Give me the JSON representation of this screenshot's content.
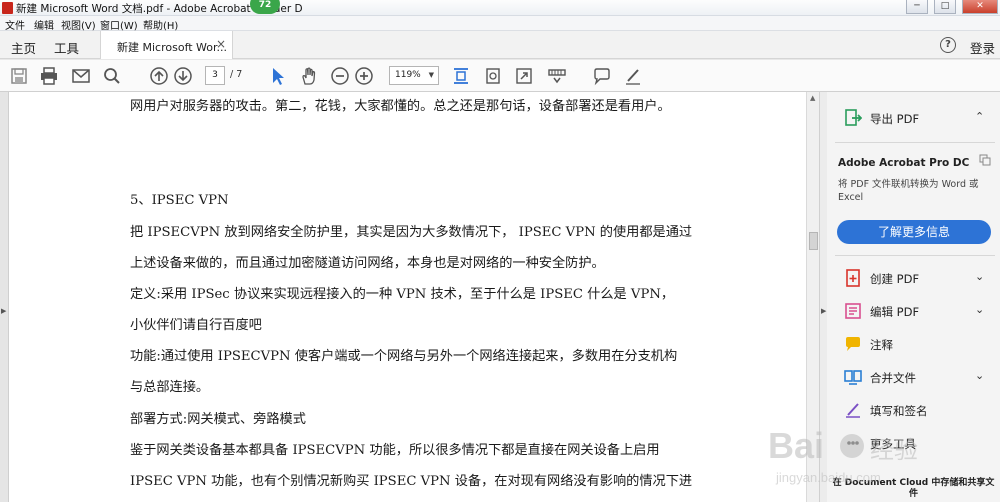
{
  "window": {
    "title": "新建 Microsoft Word 文档.pdf - Adobe Acrobat Reader D",
    "badge": "72",
    "buttons": {
      "min": "─",
      "max": "□",
      "close": "✕"
    }
  },
  "menu": [
    "文件",
    "编辑",
    "视图(V)",
    "窗口(W)",
    "帮助(H)"
  ],
  "tabs": {
    "home": "主页",
    "tools": "工具",
    "document": "新建 Microsoft Wor...",
    "close": "×",
    "help": "?",
    "login": "登录"
  },
  "toolbar": {
    "page_current": "3",
    "page_total": "/ 7",
    "zoom": "119%",
    "icons": [
      "save-icon",
      "print-icon",
      "email-icon",
      "search-icon",
      "page-up-icon",
      "page-down-icon",
      "select-cursor-icon",
      "hand-icon",
      "zoom-out-icon",
      "zoom-in-icon",
      "fit-page-icon",
      "rotate-icon",
      "fullscreen-icon",
      "scroll-mode-icon",
      "comment-icon",
      "sign-icon"
    ]
  },
  "document": {
    "lines": [
      "网用户对服务器的攻击。第二，花钱，大家都懂的。总之还是那句话，设备部署还是看用户。",
      "5、IPSEC VPN",
      "把  IPSECVPN 放到网络安全防护里，其实是因为大多数情况下，   IPSEC VPN 的使用都是通过",
      "上述设备来做的，而且通过加密隧道访问网络，本身也是对网络的一种安全防护。",
      "定义:采用  IPSec  协议来实现远程接入的一种  VPN  技术，至于什么是  IPSEC  什么是  VPN，",
      "小伙伴们请自行百度吧",
      "功能:通过使用  IPSECVPN 使客户端或一个网络与另外一个网络连接起来，多数用在分支机构",
      "与总部连接。",
      "部署方式:网关模式、旁路模式",
      "鉴于网关类设备基本都具备  IPSECVPN  功能，所以很多情况下都是直接在网关设备上启用",
      "IPSEC VPN 功能，也有个别情况新购买 IPSEC VPN 设备，在对现有网络没有影响的情况下进"
    ]
  },
  "right_panel": {
    "export_pdf": "导出 PDF",
    "product_name": "Adobe Acrobat Pro DC",
    "product_desc": "将 PDF 文件联机转换为 Word 或 Excel",
    "learn_more": "了解更多信息",
    "tools": [
      {
        "label": "创建 PDF",
        "has_chevron": true
      },
      {
        "label": "编辑 PDF",
        "has_chevron": true
      },
      {
        "label": "注释",
        "has_chevron": false
      },
      {
        "label": "合并文件",
        "has_chevron": true
      },
      {
        "label": "填写和签名",
        "has_chevron": false
      },
      {
        "label": "更多工具",
        "has_chevron": false
      }
    ],
    "cloud_note": "在 Document Cloud 中存储和共享文件"
  },
  "colors": {
    "accent_blue": "#2d73d6",
    "export_green": "#2a9d5c",
    "create_red": "#d9342b",
    "edit_pink": "#d94f8f",
    "comment_yellow": "#f0b400",
    "combine_blue": "#2a7fd4",
    "sign_purple": "#7a4fc4"
  },
  "watermark": {
    "brand": "Bai",
    "suffix": "经验",
    "url": "jingyan.baidu.com"
  }
}
